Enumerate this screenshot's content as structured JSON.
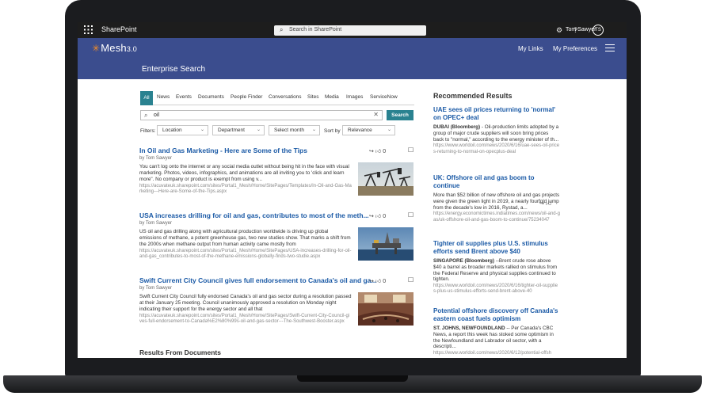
{
  "suite_bar": {
    "app_name": "SharePoint",
    "search_placeholder": "Search in SharePoint",
    "user_name": "Tom Sawyer",
    "user_initials": "TS"
  },
  "header": {
    "logo_text": "Mesh",
    "logo_version": "3.0",
    "nav": [
      "My Links",
      "My Preferences"
    ],
    "page_title": "Enterprise Search"
  },
  "search": {
    "tabs": [
      "All",
      "News",
      "Events",
      "Documents",
      "People Finder",
      "Conversations",
      "Sites",
      "Media",
      "Images",
      "ServiceNow"
    ],
    "active_tab": "All",
    "query": "oil",
    "button_label": "Search",
    "filters_label": "Filters:",
    "filters": [
      "Location",
      "Department",
      "Select month"
    ],
    "sort_label": "Sort by",
    "sort_value": "Relevance"
  },
  "results": [
    {
      "title": "In Oil and Gas Marketing - Here are Some of the Tips",
      "author": "by Tom Sawyer",
      "description": "You can't log onto the internet or any social media outlet without being hit in the face with visual marketing. Photos, videos, infographics, and animations are all inviting you to 'click and learn more\". No company or product is exempt from using v...",
      "url": "https://acuvateuk.sharepoint.com/sites/Portal1_Mesh/Home/SitePages/Templates/In-Oil-and-Gas-Marketing---Here-are-Some-of-the-Tips.aspx",
      "like_count": "0"
    },
    {
      "title": "USA increases drilling for oil and gas, contributes to most of the meth...",
      "author": "by Tom Sawyer",
      "description": "US oil and gas drilling along with agricultural production worldwide is driving up global emissions of methane, a potent greenhouse gas, two new studies show. That marks a shift from the 2000s when methane output from human activity came mostly from",
      "url": "https://acuvateuk.sharepoint.com/sites/Portal1_Mesh/Home/SitePages/USA-increases-drilling-for-oil-and-gas_contributes-to-most-of-the-methane-emissions-globally-finds-two-studie.aspx",
      "like_count": "0"
    },
    {
      "title": "Swift Current City Council gives full endorsement to Canada's oil and ga...",
      "author": "by Tom Sawyer",
      "description": "Swift Current City Council fully endorsed Canada's oil and gas sector during a resolution passed at their January 25 meeting. Council unanimously approved a resolution on Monday night indicating their support for the energy sector and all that",
      "url": "https://acuvateuk.sharepoint.com/sites/Portal1_Mesh/Home/SitePages/Swift-Current-City-Council-gives-full-endorsement-to-Canada%E2%80%99s-oil-and-gas-sector---The-Southwest-Booster.aspx",
      "like_count": "0"
    }
  ],
  "documents_heading": "Results From Documents",
  "recommended": {
    "heading": "Recommended Results",
    "items": [
      {
        "title": "UAE sees oil prices returning to 'normal' on OPEC+ deal",
        "lead": "DUBAI (Bloomberg)",
        "description": " - Oil-production limits adopted by a group of major crude suppliers will soon bring prices back to \"normal,\" according to the energy minister of th...",
        "url": "https://www.worldoil.com/news/2020/6/16/uae-sees-oil-prices-returning-to-normal-on-opecplus-deal"
      },
      {
        "title": "UK: Offshore oil and gas boom to continue",
        "lead": "",
        "description": "More than $52 billion of new offshore oil and gas projects were given the green light in 2019, a nearly fourfold jump from the decade's low in 2016, Rystad, a...",
        "url": "https://energy.economictimes.indiatimes.com/news/oil-and-gas/uk-offshore-oil-and-gas-boom-to-continue/75234047"
      },
      {
        "title": "Tighter oil supplies plus U.S. stimulus efforts send Brent above $40",
        "lead": "SINGAPORE (Bloomberg)",
        "description": " --Brent crude rose above $40 a barrel as broader markets rallied on stimulus from the Federal Reserve and physical supplies continued to tighten.",
        "url": "https://www.worldoil.com/news/2020/6/16/tighter-oil-supplies-plus-us-stimulus-efforts-send-brent-above-40"
      },
      {
        "title": "Potential offshore discovery off Canada's eastern coast fuels optimism",
        "lead": "ST. JOHNS, NEWFOUNDLAND",
        "description": " -- Per Canada's CBC News, a report this week has stoked some optimism in the Newfoundland and Labrador oil sector, with a descripti...",
        "url": "https://www.worldoil.com/news/2020/6/12/potential-offsh"
      }
    ]
  },
  "icons": {
    "waffle": "waffle-icon",
    "settings": "gear-icon",
    "help": "help-icon",
    "search": "search-icon",
    "like": "thumbs-up-icon",
    "share": "share-icon",
    "bookmark": "bookmark-icon"
  },
  "colors": {
    "suite_bar": "#1d1d1d",
    "header": "#3b4d8e",
    "accent": "#2a8290",
    "link": "#1b5aa6",
    "logo_star": "#f28c28"
  }
}
